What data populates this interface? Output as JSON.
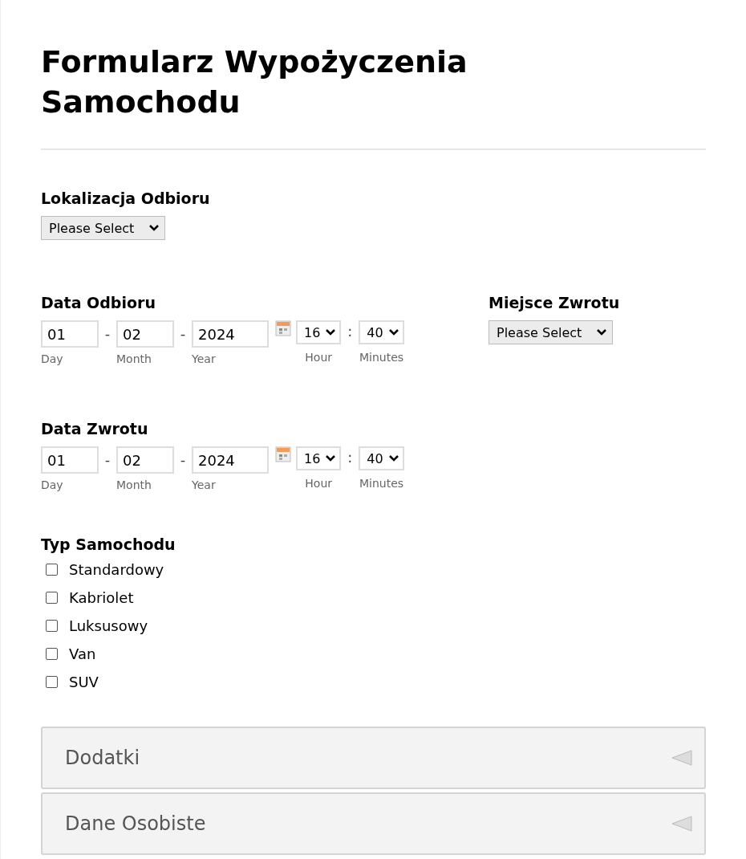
{
  "title": "Formularz Wypożyczenia Samochodu",
  "pickup_location": {
    "label": "Lokalizacja Odbioru",
    "select": "Please Select"
  },
  "pickup_date": {
    "label": "Data Odbioru",
    "date_separator": "-",
    "time_separator": ":",
    "date_fields": [
      {
        "value": "01",
        "sublabel": "Day",
        "kind": "short"
      },
      {
        "value": "02",
        "sublabel": "Month",
        "kind": "short"
      },
      {
        "value": "2024",
        "sublabel": "Year",
        "kind": "long"
      }
    ],
    "hour": {
      "value": "16",
      "sublabel": "Hour"
    },
    "minute": {
      "value": "40",
      "sublabel": "Minutes"
    }
  },
  "return_place": {
    "label": "Miejsce Zwrotu",
    "select": "Please Select"
  },
  "return_date": {
    "label": "Data Zwrotu",
    "date_separator": "-",
    "time_separator": ":",
    "date_fields": [
      {
        "value": "01",
        "sublabel": "Day",
        "kind": "short"
      },
      {
        "value": "02",
        "sublabel": "Month",
        "kind": "short"
      },
      {
        "value": "2024",
        "sublabel": "Year",
        "kind": "long"
      }
    ],
    "hour": {
      "value": "16",
      "sublabel": "Hour"
    },
    "minute": {
      "value": "40",
      "sublabel": "Minutes"
    }
  },
  "car_type": {
    "label": "Typ Samochodu",
    "options": [
      {
        "label": "Standardowy",
        "checked": false
      },
      {
        "label": "Kabriolet",
        "checked": false
      },
      {
        "label": "Luksusowy",
        "checked": false
      },
      {
        "label": "Van",
        "checked": false
      },
      {
        "label": "SUV",
        "checked": false
      }
    ]
  },
  "panels": [
    {
      "title": "Dodatki",
      "expanded": false
    },
    {
      "title": "Dane Osobiste",
      "expanded": false
    }
  ]
}
